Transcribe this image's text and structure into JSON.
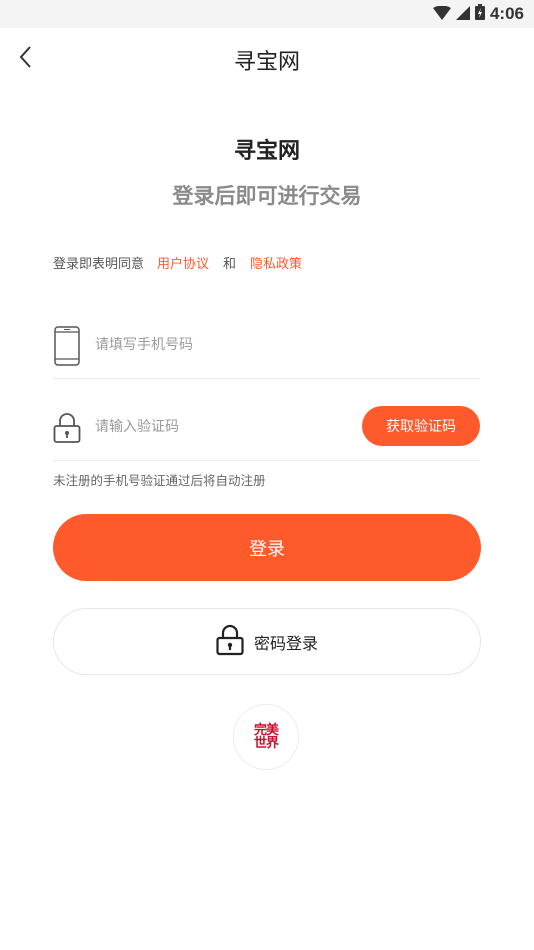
{
  "status_bar": {
    "time": "4:06"
  },
  "nav": {
    "title": "寻宝网"
  },
  "header": {
    "brand": "寻宝网",
    "subtitle": "登录后即可进行交易"
  },
  "agreement": {
    "prefix": "登录即表明同意",
    "user_agreement": "用户协议",
    "conjunction": "和",
    "privacy_policy": "隐私政策"
  },
  "form": {
    "phone_placeholder": "请填写手机号码",
    "code_placeholder": "请输入验证码",
    "get_code_label": "获取验证码",
    "hint": "未注册的手机号验证通过后将自动注册"
  },
  "actions": {
    "login_label": "登录",
    "password_login_label": "密码登录"
  },
  "third_party": {
    "logo_line1": "完美",
    "logo_line2": "世界"
  },
  "colors": {
    "accent": "#ff5a2c",
    "logo_red": "#c8102e"
  }
}
